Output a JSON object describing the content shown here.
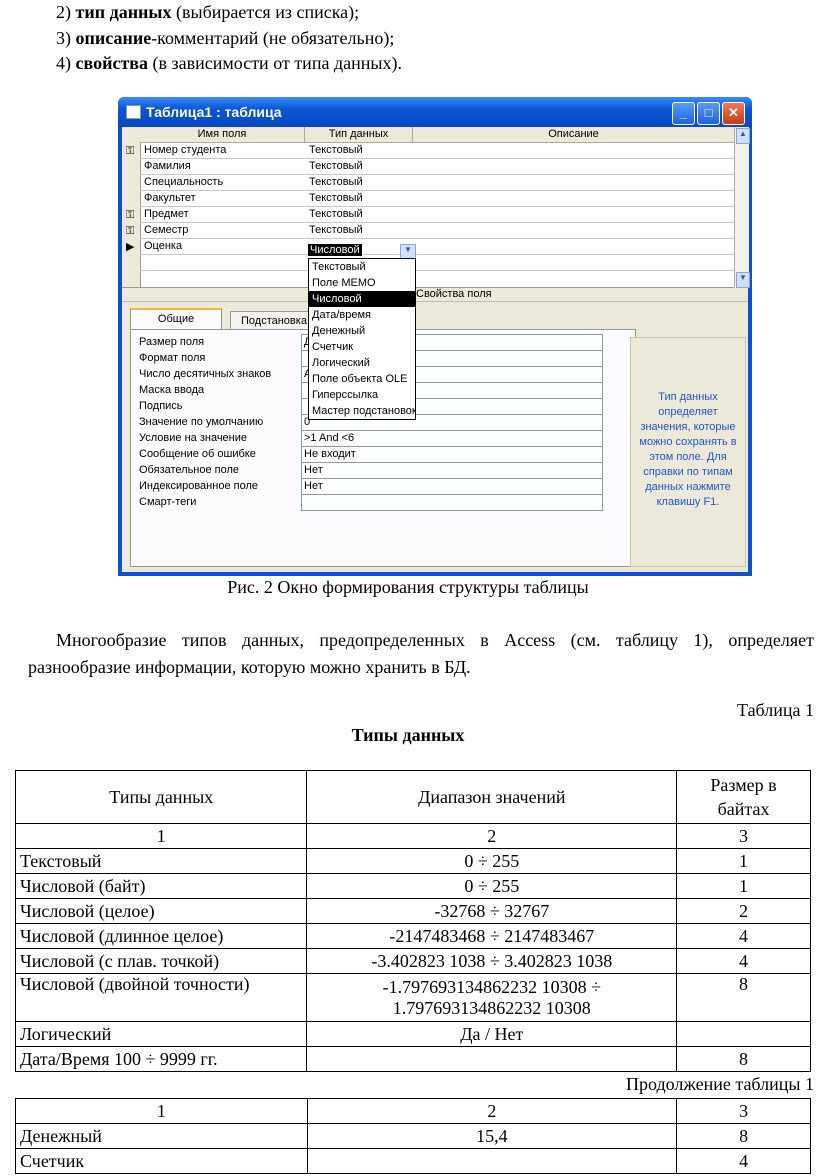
{
  "intro_lines": [
    {
      "num": "2)",
      "bold": "тип данных",
      "rest": " (выбирается из списка);"
    },
    {
      "num": "3)",
      "bold": "описание",
      "rest": "-комментарий (не обязательно);"
    },
    {
      "num": "4)",
      "bold": "свойства",
      "rest": " (в зависимости от типа данных)."
    }
  ],
  "window": {
    "title": "Таблица1 : таблица",
    "controls": [
      "_",
      "□",
      "✕"
    ],
    "headers": [
      "Имя поля",
      "Тип данных",
      "Описание"
    ],
    "rows": [
      {
        "key": true,
        "name": "Номер студента",
        "type": "Текстовый"
      },
      {
        "key": false,
        "name": "Фамилия",
        "type": "Текстовый"
      },
      {
        "key": false,
        "name": "Специальность",
        "type": "Текстовый"
      },
      {
        "key": false,
        "name": "Факультет",
        "type": "Текстовый"
      },
      {
        "key": true,
        "name": "Предмет",
        "type": "Текстовый"
      },
      {
        "key": true,
        "name": "Семестр",
        "type": "Текстовый"
      },
      {
        "key": false,
        "name": "Оценка",
        "type": "Числовой"
      }
    ],
    "current_row_marker": "▶",
    "properties_label": "Свойства поля",
    "tabs": [
      "Общие",
      "Подстановка"
    ],
    "dropdown": [
      "Текстовый",
      "Поле MEMO",
      "Числовой",
      "Дата/время",
      "Денежный",
      "Счетчик",
      "Логический",
      "Поле объекта OLE",
      "Гиперссылка",
      "Мастер подстановок..."
    ],
    "dropdown_selected": "Числовой",
    "properties": [
      {
        "label": "Размер поля",
        "value": "Д"
      },
      {
        "label": "Формат поля",
        "value": ""
      },
      {
        "label": "Число десятичных знаков",
        "value": "А"
      },
      {
        "label": "Маска ввода",
        "value": ""
      },
      {
        "label": "Подпись",
        "value": ""
      },
      {
        "label": "Значение по умолчанию",
        "value": "0"
      },
      {
        "label": "Условие на значение",
        "value": ">1 And <6"
      },
      {
        "label": "Сообщение об ошибке",
        "value": "Не входит"
      },
      {
        "label": "Обязательное поле",
        "value": "Нет"
      },
      {
        "label": "Индексированное поле",
        "value": "Нет"
      },
      {
        "label": "Смарт-теги",
        "value": ""
      }
    ],
    "help_text": "Тип данных определяет значения, которые можно сохранять в этом поле. Для справки по типам данных нажмите клавишу F1."
  },
  "caption": "Рис. 2 Окно формирования структуры таблицы",
  "paragraph": "Многообразие типов данных, предопределенных в Access (см. таблицу 1), определяет разнообразие информации, которую можно хранить в БД.",
  "table_label": "Таблица 1",
  "table_title": "Типы данных",
  "table": {
    "headers": [
      "Типы данных",
      "Диапазон значений",
      "Размер в байтах"
    ],
    "numbers": [
      "1",
      "2",
      "3"
    ],
    "rows": [
      [
        "Текстовый",
        "0 ÷ 255",
        "1"
      ],
      [
        "Числовой (байт)",
        "0 ÷ 255",
        "1"
      ],
      [
        "Числовой (целое)",
        "-32768 ÷ 32767",
        "2"
      ],
      [
        "Числовой (длинное целое)",
        "-2147483468 ÷ 2147483467",
        "4"
      ],
      [
        "Числовой (с плав. точкой)",
        "-3.402823 1038 ÷ 3.402823 1038",
        "4"
      ],
      [
        "Числовой (двойной точности)",
        "-1.797693134862232 10308 ÷ 1.797693134862232 10308",
        "8"
      ],
      [
        "Логический",
        "Да / Нет",
        ""
      ],
      [
        "Дата/Время 100 ÷ 9999 гг.",
        "",
        "8"
      ]
    ]
  },
  "continuation_label": "Продолжение таблицы 1",
  "table2": {
    "numbers": [
      "1",
      "2",
      "3"
    ],
    "rows": [
      [
        "Денежный",
        "15,4",
        "8"
      ],
      [
        "Счетчик",
        "",
        "4"
      ]
    ]
  }
}
